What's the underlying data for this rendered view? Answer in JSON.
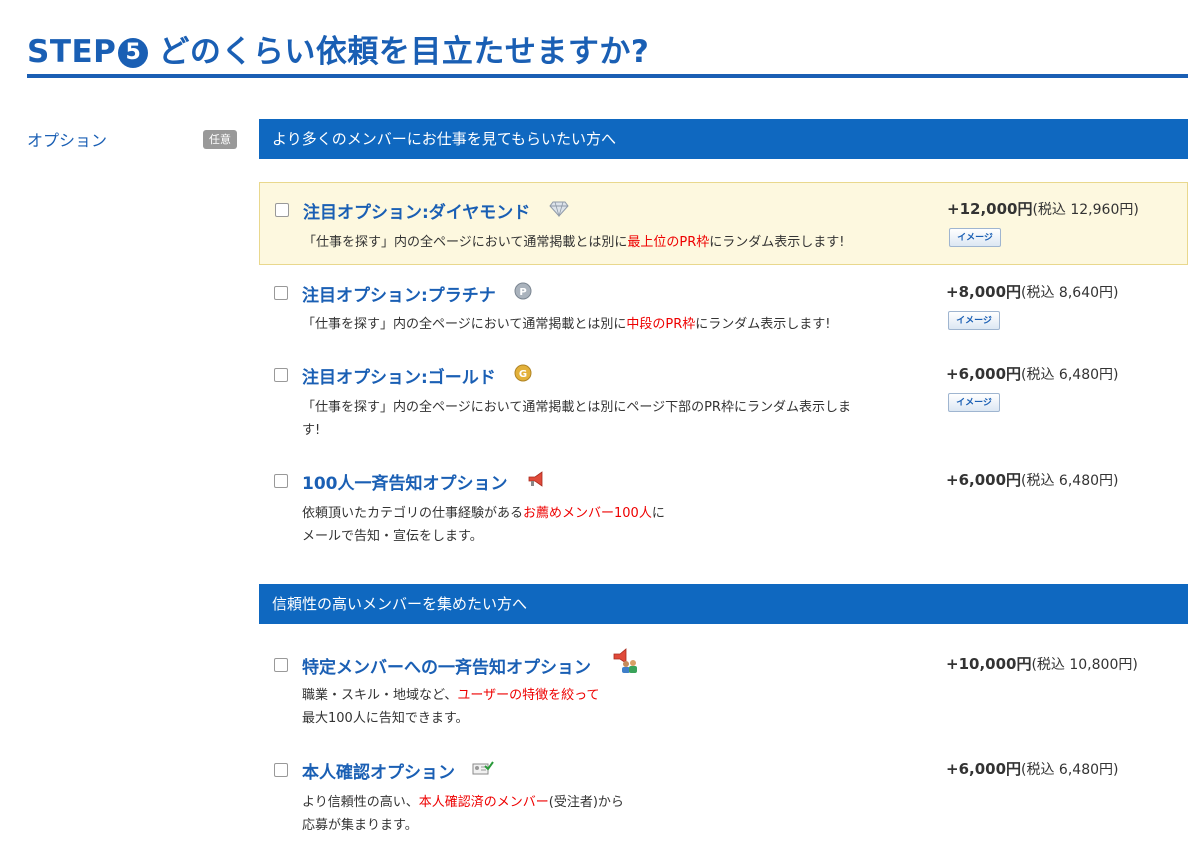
{
  "step": {
    "prefix": "STEP",
    "number": "5",
    "title": "どのくらい依頼を目立たせますか?"
  },
  "option_label": "オプション",
  "optional_badge": "任意",
  "sections": [
    {
      "header": "より多くのメンバーにお仕事を見てもらいたい方へ"
    },
    {
      "header": "信頼性の高いメンバーを集めたい方へ"
    }
  ],
  "image_button_label": "イメージ",
  "options": [
    {
      "name": "注目オプション:ダイヤモンド",
      "icon": "diamond-icon",
      "price": "+12,000円",
      "tax": "(税込 12,960円)",
      "desc_pre": "「仕事を探す」内の全ページにおいて通常掲載とは別に",
      "desc_red": "最上位のPR枠",
      "desc_post": "にランダム表示します!"
    },
    {
      "name": "注目オプション:プラチナ",
      "icon": "platinum-icon",
      "price": "+8,000円",
      "tax": "(税込 8,640円)",
      "desc_pre": "「仕事を探す」内の全ページにおいて通常掲載とは別に",
      "desc_red": "中段のPR枠",
      "desc_post": "にランダム表示します!"
    },
    {
      "name": "注目オプション:ゴールド",
      "icon": "gold-icon",
      "price": "+6,000円",
      "tax": "(税込 6,480円)",
      "desc_line1": "「仕事を探す」内の全ページにおいて通常掲載とは別にページ下部のPR枠にランダム表示しま",
      "desc_line2": "す!"
    },
    {
      "name": "100人一斉告知オプション",
      "icon": "megaphone-icon",
      "price": "+6,000円",
      "tax": "(税込 6,480円)",
      "desc_pre": "依頼頂いたカテゴリの仕事経験がある",
      "desc_red": "お薦めメンバー100人",
      "desc_post": "に",
      "desc_line2": "メールで告知・宣伝をします。"
    },
    {
      "name": "特定メンバーへの一斉告知オプション",
      "icon": "group-megaphone-icon",
      "price": "+10,000円",
      "tax": "(税込 10,800円)",
      "desc_pre": "職業・スキル・地域など、",
      "desc_red": "ユーザーの特徴を絞って",
      "desc_line2": "最大100人に告知できます。"
    },
    {
      "name": "本人確認オプション",
      "icon": "id-card-icon",
      "price": "+6,000円",
      "tax": "(税込 6,480円)",
      "desc_pre": "より信頼性の高い、",
      "desc_red": "本人確認済のメンバー",
      "desc_post": "(受注者)から",
      "desc_line2": "応募が集まります。"
    }
  ],
  "colors": {
    "accent": "#1a5fb4",
    "section_bg": "#0f68c0",
    "highlight_bg": "#fdf8df",
    "emphasis": "#ee0000"
  }
}
